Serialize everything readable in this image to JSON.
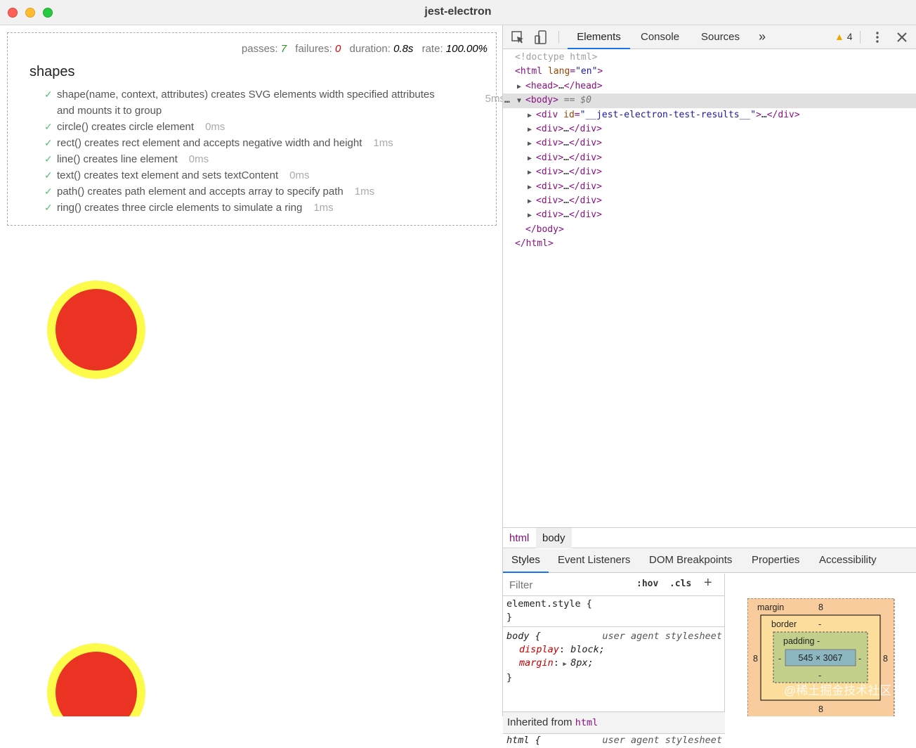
{
  "window": {
    "title": "jest-electron"
  },
  "results": {
    "stats": {
      "passes_label": "passes:",
      "passes": "7",
      "failures_label": "failures:",
      "failures": "0",
      "duration_label": "duration:",
      "duration": "0.8s",
      "rate_label": "rate:",
      "rate": "100.00%"
    },
    "suite": "shapes",
    "tests": [
      {
        "check": "✓",
        "line1": "shape(name, context, attributes) creates SVG elements width specified attributes",
        "line2": "and mounts it to group",
        "duration": "5ms"
      },
      {
        "check": "✓",
        "name": "circle() creates circle element",
        "duration": "0ms"
      },
      {
        "check": "✓",
        "name": "rect() creates rect element and accepts negative width and height",
        "duration": "1ms"
      },
      {
        "check": "✓",
        "name": "line() creates line element",
        "duration": "0ms"
      },
      {
        "check": "✓",
        "name": "text() creates text element and sets textContent",
        "duration": "0ms"
      },
      {
        "check": "✓",
        "name": "path() creates path element and accepts array to specify path",
        "duration": "1ms"
      },
      {
        "check": "✓",
        "name": "ring() creates three circle elements to simulate a ring",
        "duration": "1ms"
      }
    ],
    "ring_colors": {
      "outer": "#fdfb4a",
      "inner": "#ea3323"
    }
  },
  "devtools": {
    "tabs": [
      "Elements",
      "Console",
      "Sources",
      "»"
    ],
    "warnings": "4",
    "dom": {
      "doctype": "<!doctype html>",
      "html_open_tag": "html",
      "lang_attr": "lang",
      "lang_val": "\"en\"",
      "head": "head",
      "ellipsis": "…",
      "body": "body",
      "selected_marker": "== $0",
      "div": "div",
      "id_attr": "id",
      "id_val": "\"__jest-electron-test-results__\"",
      "dots": "…"
    },
    "breadcrumbs": [
      "html",
      "body"
    ],
    "subtabs": [
      "Styles",
      "Event Listeners",
      "DOM Breakpoints",
      "Properties",
      "Accessibility"
    ],
    "styles": {
      "filter_placeholder": "Filter",
      "hov": ":hov",
      "cls": ".cls",
      "plus": "+",
      "element_style": "element.style {",
      "close_brace": "}",
      "body_selector": "body {",
      "ua_source": "user agent stylesheet",
      "display_prop": "display",
      "display_val": "block;",
      "margin_prop": "margin",
      "margin_val": "8px;",
      "inherited_label": "Inherited from",
      "inherited_tag": "html",
      "html_selector": "html {"
    },
    "boxmodel": {
      "margin_label": "margin",
      "margin_top": "8",
      "margin_bottom": "8",
      "margin_left": "8",
      "margin_right": "8",
      "border_label": "border",
      "border_val": "-",
      "padding_label": "padding -",
      "padding_side": "-",
      "padding_bottom": "-",
      "content": "545 × 3067",
      "colors": {
        "margin": "#f9cc9d",
        "border": "#fddd9b",
        "padding": "#c3d08b",
        "content": "#8cb6c0"
      }
    },
    "watermark": "@稀土掘金技术社区"
  }
}
